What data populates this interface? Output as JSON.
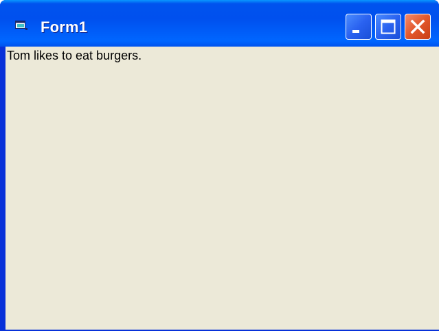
{
  "window": {
    "title": "Form1",
    "icon": "form-window-icon",
    "colors": {
      "titlebar": "#0053ee",
      "client_background": "#ece9d8",
      "close_button": "#e2572b",
      "frame": "#0831d9"
    }
  },
  "titlebar_buttons": {
    "minimize_icon": "minimize-icon",
    "maximize_icon": "maximize-icon",
    "close_icon": "close-icon"
  },
  "form": {
    "label_text": "Tom likes to eat burgers."
  }
}
